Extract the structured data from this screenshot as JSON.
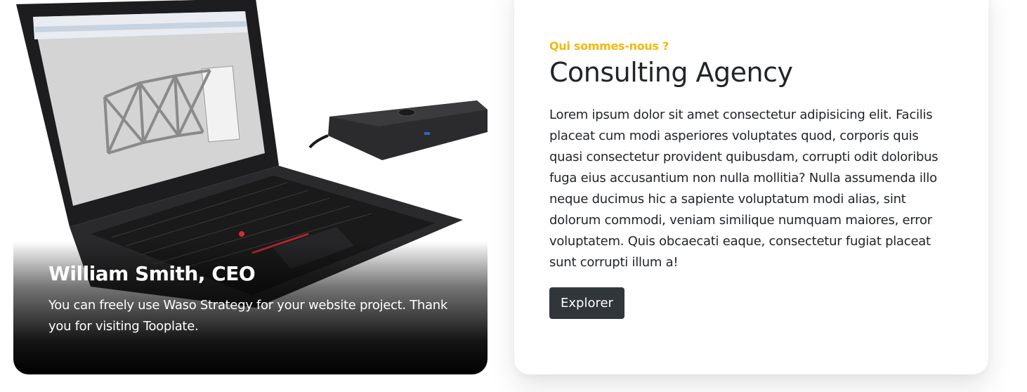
{
  "image_card": {
    "caption_title": "William Smith, CEO",
    "caption_text": "You can freely use Waso Strategy for your website project. Thank you for visiting Tooplate."
  },
  "info_card": {
    "eyebrow": "Qui sommes-nous ?",
    "title": "Consulting Agency",
    "body": "Lorem ipsum dolor sit amet consectetur adipisicing elit. Facilis placeat cum modi asperiores voluptates quod, corporis quis quasi consectetur provident quibusdam, corrupti odit doloribus fuga eius accusantium non nulla mollitia? Nulla assumenda illo neque ducimus hic a sapiente voluptatum modi alias, sint dolorum commodi, veniam similique numquam maiores, error voluptatem. Quis obcaecati eaque, consectetur fugiat placeat sunt corrupti illum a!",
    "button_label": "Explorer"
  },
  "colors": {
    "accent": "#f5b80c",
    "button_bg": "#31363b",
    "text": "#212529"
  }
}
